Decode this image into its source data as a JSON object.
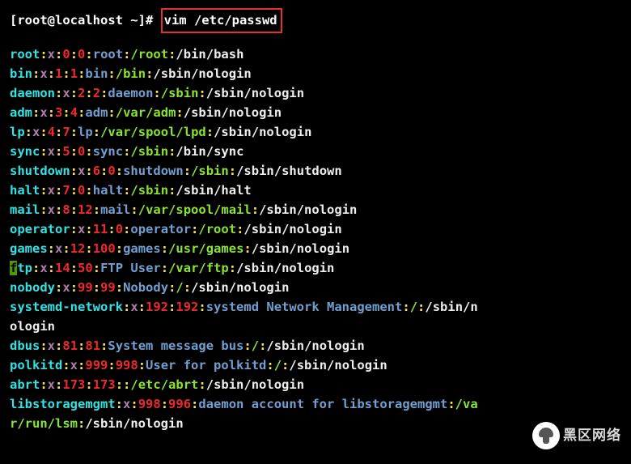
{
  "prompt": {
    "text": "[root@localhost ~]# ",
    "command": "vim /etc/passwd"
  },
  "rows": [
    [
      {
        "t": "root",
        "c": "brightcyan"
      },
      {
        "t": ":",
        "c": "yel2"
      },
      {
        "t": "x",
        "c": "brightmagenta"
      },
      {
        "t": ":",
        "c": "yel2"
      },
      {
        "t": "0",
        "c": "brightred"
      },
      {
        "t": ":",
        "c": "yel2"
      },
      {
        "t": "0",
        "c": "brightred"
      },
      {
        "t": ":",
        "c": "yel2"
      },
      {
        "t": "root",
        "c": "brightblue"
      },
      {
        "t": ":",
        "c": "yel2"
      },
      {
        "t": "/root",
        "c": "brightgreen"
      },
      {
        "t": ":",
        "c": "yel2"
      },
      {
        "t": "/bin/bash",
        "c": "boldwhite"
      }
    ],
    [
      {
        "t": "bin",
        "c": "brightcyan"
      },
      {
        "t": ":",
        "c": "yel2"
      },
      {
        "t": "x",
        "c": "brightmagenta"
      },
      {
        "t": ":",
        "c": "yel2"
      },
      {
        "t": "1",
        "c": "brightred"
      },
      {
        "t": ":",
        "c": "yel2"
      },
      {
        "t": "1",
        "c": "brightred"
      },
      {
        "t": ":",
        "c": "yel2"
      },
      {
        "t": "bin",
        "c": "brightblue"
      },
      {
        "t": ":",
        "c": "yel2"
      },
      {
        "t": "/bin",
        "c": "brightgreen"
      },
      {
        "t": ":",
        "c": "yel2"
      },
      {
        "t": "/sbin/nologin",
        "c": "boldwhite"
      }
    ],
    [
      {
        "t": "daemon",
        "c": "brightcyan"
      },
      {
        "t": ":",
        "c": "yel2"
      },
      {
        "t": "x",
        "c": "brightmagenta"
      },
      {
        "t": ":",
        "c": "yel2"
      },
      {
        "t": "2",
        "c": "brightred"
      },
      {
        "t": ":",
        "c": "yel2"
      },
      {
        "t": "2",
        "c": "brightred"
      },
      {
        "t": ":",
        "c": "yel2"
      },
      {
        "t": "daemon",
        "c": "brightblue"
      },
      {
        "t": ":",
        "c": "yel2"
      },
      {
        "t": "/sbin",
        "c": "brightgreen"
      },
      {
        "t": ":",
        "c": "yel2"
      },
      {
        "t": "/sbin/nologin",
        "c": "boldwhite"
      }
    ],
    [
      {
        "t": "adm",
        "c": "brightcyan"
      },
      {
        "t": ":",
        "c": "yel2"
      },
      {
        "t": "x",
        "c": "brightmagenta"
      },
      {
        "t": ":",
        "c": "yel2"
      },
      {
        "t": "3",
        "c": "brightred"
      },
      {
        "t": ":",
        "c": "yel2"
      },
      {
        "t": "4",
        "c": "brightred"
      },
      {
        "t": ":",
        "c": "yel2"
      },
      {
        "t": "adm",
        "c": "brightblue"
      },
      {
        "t": ":",
        "c": "yel2"
      },
      {
        "t": "/var/adm",
        "c": "brightgreen"
      },
      {
        "t": ":",
        "c": "yel2"
      },
      {
        "t": "/sbin/nologin",
        "c": "boldwhite"
      }
    ],
    [
      {
        "t": "lp",
        "c": "brightcyan"
      },
      {
        "t": ":",
        "c": "yel2"
      },
      {
        "t": "x",
        "c": "brightmagenta"
      },
      {
        "t": ":",
        "c": "yel2"
      },
      {
        "t": "4",
        "c": "brightred"
      },
      {
        "t": ":",
        "c": "yel2"
      },
      {
        "t": "7",
        "c": "brightred"
      },
      {
        "t": ":",
        "c": "yel2"
      },
      {
        "t": "lp",
        "c": "brightblue"
      },
      {
        "t": ":",
        "c": "yel2"
      },
      {
        "t": "/var/spool/lpd",
        "c": "brightgreen"
      },
      {
        "t": ":",
        "c": "yel2"
      },
      {
        "t": "/sbin/nologin",
        "c": "boldwhite"
      }
    ],
    [
      {
        "t": "sync",
        "c": "brightcyan"
      },
      {
        "t": ":",
        "c": "yel2"
      },
      {
        "t": "x",
        "c": "brightmagenta"
      },
      {
        "t": ":",
        "c": "yel2"
      },
      {
        "t": "5",
        "c": "brightred"
      },
      {
        "t": ":",
        "c": "yel2"
      },
      {
        "t": "0",
        "c": "brightred"
      },
      {
        "t": ":",
        "c": "yel2"
      },
      {
        "t": "sync",
        "c": "brightblue"
      },
      {
        "t": ":",
        "c": "yel2"
      },
      {
        "t": "/sbin",
        "c": "brightgreen"
      },
      {
        "t": ":",
        "c": "yel2"
      },
      {
        "t": "/bin/sync",
        "c": "boldwhite"
      }
    ],
    [
      {
        "t": "shutdown",
        "c": "brightcyan"
      },
      {
        "t": ":",
        "c": "yel2"
      },
      {
        "t": "x",
        "c": "brightmagenta"
      },
      {
        "t": ":",
        "c": "yel2"
      },
      {
        "t": "6",
        "c": "brightred"
      },
      {
        "t": ":",
        "c": "yel2"
      },
      {
        "t": "0",
        "c": "brightred"
      },
      {
        "t": ":",
        "c": "yel2"
      },
      {
        "t": "shutdown",
        "c": "brightblue"
      },
      {
        "t": ":",
        "c": "yel2"
      },
      {
        "t": "/sbin",
        "c": "brightgreen"
      },
      {
        "t": ":",
        "c": "yel2"
      },
      {
        "t": "/sbin/shutdown",
        "c": "boldwhite"
      }
    ],
    [
      {
        "t": "halt",
        "c": "brightcyan"
      },
      {
        "t": ":",
        "c": "yel2"
      },
      {
        "t": "x",
        "c": "brightmagenta"
      },
      {
        "t": ":",
        "c": "yel2"
      },
      {
        "t": "7",
        "c": "brightred"
      },
      {
        "t": ":",
        "c": "yel2"
      },
      {
        "t": "0",
        "c": "brightred"
      },
      {
        "t": ":",
        "c": "yel2"
      },
      {
        "t": "halt",
        "c": "brightblue"
      },
      {
        "t": ":",
        "c": "yel2"
      },
      {
        "t": "/sbin",
        "c": "brightgreen"
      },
      {
        "t": ":",
        "c": "yel2"
      },
      {
        "t": "/sbin/halt",
        "c": "boldwhite"
      }
    ],
    [
      {
        "t": "mail",
        "c": "brightcyan"
      },
      {
        "t": ":",
        "c": "yel2"
      },
      {
        "t": "x",
        "c": "brightmagenta"
      },
      {
        "t": ":",
        "c": "yel2"
      },
      {
        "t": "8",
        "c": "brightred"
      },
      {
        "t": ":",
        "c": "yel2"
      },
      {
        "t": "12",
        "c": "brightred"
      },
      {
        "t": ":",
        "c": "yel2"
      },
      {
        "t": "mail",
        "c": "brightblue"
      },
      {
        "t": ":",
        "c": "yel2"
      },
      {
        "t": "/var/spool/mail",
        "c": "brightgreen"
      },
      {
        "t": ":",
        "c": "yel2"
      },
      {
        "t": "/sbin/nologin",
        "c": "boldwhite"
      }
    ],
    [
      {
        "t": "operator",
        "c": "brightcyan"
      },
      {
        "t": ":",
        "c": "yel2"
      },
      {
        "t": "x",
        "c": "brightmagenta"
      },
      {
        "t": ":",
        "c": "yel2"
      },
      {
        "t": "11",
        "c": "brightred"
      },
      {
        "t": ":",
        "c": "yel2"
      },
      {
        "t": "0",
        "c": "brightred"
      },
      {
        "t": ":",
        "c": "yel2"
      },
      {
        "t": "operator",
        "c": "brightblue"
      },
      {
        "t": ":",
        "c": "yel2"
      },
      {
        "t": "/root",
        "c": "brightgreen"
      },
      {
        "t": ":",
        "c": "yel2"
      },
      {
        "t": "/sbin/nologin",
        "c": "boldwhite"
      }
    ],
    [
      {
        "t": "games",
        "c": "brightcyan"
      },
      {
        "t": ":",
        "c": "yel2"
      },
      {
        "t": "x",
        "c": "brightmagenta"
      },
      {
        "t": ":",
        "c": "yel2"
      },
      {
        "t": "12",
        "c": "brightred"
      },
      {
        "t": ":",
        "c": "yel2"
      },
      {
        "t": "100",
        "c": "brightred"
      },
      {
        "t": ":",
        "c": "yel2"
      },
      {
        "t": "games",
        "c": "brightblue"
      },
      {
        "t": ":",
        "c": "yel2"
      },
      {
        "t": "/usr/games",
        "c": "brightgreen"
      },
      {
        "t": ":",
        "c": "yel2"
      },
      {
        "t": "/sbin/nologin",
        "c": "boldwhite"
      }
    ],
    [
      {
        "t": "f",
        "c": "cursor"
      },
      {
        "t": "tp",
        "c": "brightcyan"
      },
      {
        "t": ":",
        "c": "yel2"
      },
      {
        "t": "x",
        "c": "brightmagenta"
      },
      {
        "t": ":",
        "c": "yel2"
      },
      {
        "t": "14",
        "c": "brightred"
      },
      {
        "t": ":",
        "c": "yel2"
      },
      {
        "t": "50",
        "c": "brightred"
      },
      {
        "t": ":",
        "c": "yel2"
      },
      {
        "t": "FTP User",
        "c": "brightblue"
      },
      {
        "t": ":",
        "c": "yel2"
      },
      {
        "t": "/var/ftp",
        "c": "brightgreen"
      },
      {
        "t": ":",
        "c": "yel2"
      },
      {
        "t": "/sbin/nologin",
        "c": "boldwhite"
      }
    ],
    [
      {
        "t": "nobody",
        "c": "brightcyan"
      },
      {
        "t": ":",
        "c": "yel2"
      },
      {
        "t": "x",
        "c": "brightmagenta"
      },
      {
        "t": ":",
        "c": "yel2"
      },
      {
        "t": "99",
        "c": "brightred"
      },
      {
        "t": ":",
        "c": "yel2"
      },
      {
        "t": "99",
        "c": "brightred"
      },
      {
        "t": ":",
        "c": "yel2"
      },
      {
        "t": "Nobody",
        "c": "brightblue"
      },
      {
        "t": ":",
        "c": "yel2"
      },
      {
        "t": "/",
        "c": "brightgreen"
      },
      {
        "t": ":",
        "c": "yel2"
      },
      {
        "t": "/sbin/nologin",
        "c": "boldwhite"
      }
    ],
    [
      {
        "t": "systemd-network",
        "c": "brightcyan"
      },
      {
        "t": ":",
        "c": "yel2"
      },
      {
        "t": "x",
        "c": "brightmagenta"
      },
      {
        "t": ":",
        "c": "yel2"
      },
      {
        "t": "192",
        "c": "brightred"
      },
      {
        "t": ":",
        "c": "yel2"
      },
      {
        "t": "192",
        "c": "brightred"
      },
      {
        "t": ":",
        "c": "yel2"
      },
      {
        "t": "systemd Network Management",
        "c": "brightblue"
      },
      {
        "t": ":",
        "c": "yel2"
      },
      {
        "t": "/",
        "c": "brightgreen"
      },
      {
        "t": ":",
        "c": "yel2"
      },
      {
        "t": "/sbin/n",
        "c": "boldwhite"
      }
    ],
    [
      {
        "t": "ologin",
        "c": "boldwhite"
      }
    ],
    [
      {
        "t": "dbus",
        "c": "brightcyan"
      },
      {
        "t": ":",
        "c": "yel2"
      },
      {
        "t": "x",
        "c": "brightmagenta"
      },
      {
        "t": ":",
        "c": "yel2"
      },
      {
        "t": "81",
        "c": "brightred"
      },
      {
        "t": ":",
        "c": "yel2"
      },
      {
        "t": "81",
        "c": "brightred"
      },
      {
        "t": ":",
        "c": "yel2"
      },
      {
        "t": "System message bus",
        "c": "brightblue"
      },
      {
        "t": ":",
        "c": "yel2"
      },
      {
        "t": "/",
        "c": "brightgreen"
      },
      {
        "t": ":",
        "c": "yel2"
      },
      {
        "t": "/sbin/nologin",
        "c": "boldwhite"
      }
    ],
    [
      {
        "t": "polkitd",
        "c": "brightcyan"
      },
      {
        "t": ":",
        "c": "yel2"
      },
      {
        "t": "x",
        "c": "brightmagenta"
      },
      {
        "t": ":",
        "c": "yel2"
      },
      {
        "t": "999",
        "c": "brightred"
      },
      {
        "t": ":",
        "c": "yel2"
      },
      {
        "t": "998",
        "c": "brightred"
      },
      {
        "t": ":",
        "c": "yel2"
      },
      {
        "t": "User for polkitd",
        "c": "brightblue"
      },
      {
        "t": ":",
        "c": "yel2"
      },
      {
        "t": "/",
        "c": "brightgreen"
      },
      {
        "t": ":",
        "c": "yel2"
      },
      {
        "t": "/sbin/nologin",
        "c": "boldwhite"
      }
    ],
    [
      {
        "t": "abrt",
        "c": "brightcyan"
      },
      {
        "t": ":",
        "c": "yel2"
      },
      {
        "t": "x",
        "c": "brightmagenta"
      },
      {
        "t": ":",
        "c": "yel2"
      },
      {
        "t": "173",
        "c": "brightred"
      },
      {
        "t": ":",
        "c": "yel2"
      },
      {
        "t": "173",
        "c": "brightred"
      },
      {
        "t": ":",
        "c": "yel2"
      },
      {
        "t": ":",
        "c": "yel2"
      },
      {
        "t": "/etc/abrt",
        "c": "brightgreen"
      },
      {
        "t": ":",
        "c": "yel2"
      },
      {
        "t": "/sbin/nologin",
        "c": "boldwhite"
      }
    ],
    [
      {
        "t": "libstoragemgmt",
        "c": "brightcyan"
      },
      {
        "t": ":",
        "c": "yel2"
      },
      {
        "t": "x",
        "c": "brightmagenta"
      },
      {
        "t": ":",
        "c": "yel2"
      },
      {
        "t": "998",
        "c": "brightred"
      },
      {
        "t": ":",
        "c": "yel2"
      },
      {
        "t": "996",
        "c": "brightred"
      },
      {
        "t": ":",
        "c": "yel2"
      },
      {
        "t": "daemon account for libstoragemgmt",
        "c": "brightblue"
      },
      {
        "t": ":",
        "c": "yel2"
      },
      {
        "t": "/va",
        "c": "brightgreen"
      }
    ],
    [
      {
        "t": "r/run/lsm",
        "c": "brightgreen"
      },
      {
        "t": ":",
        "c": "yel2"
      },
      {
        "t": "/sbin/nologin",
        "c": "boldwhite"
      }
    ]
  ],
  "watermark": "黑区网络"
}
